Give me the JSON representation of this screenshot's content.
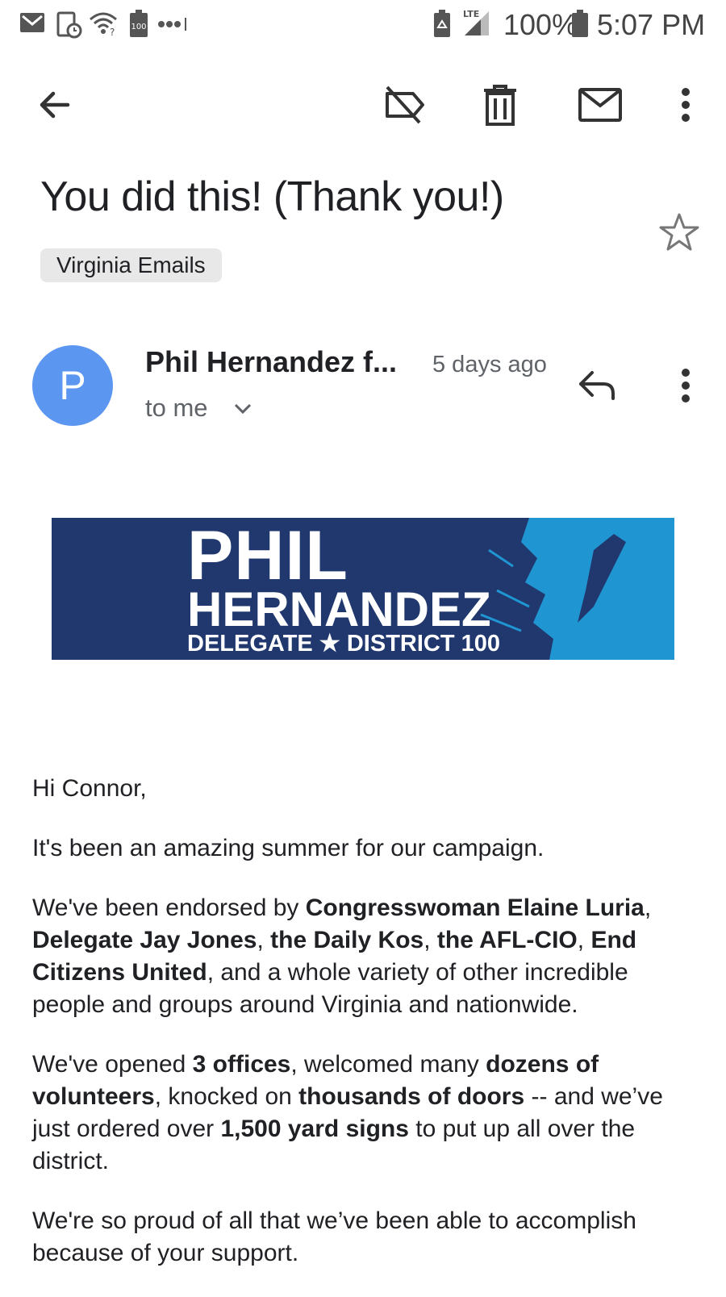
{
  "status_bar": {
    "icons": [
      "gmail-icon",
      "tablet-clock-icon",
      "wifi-icon",
      "battery-100-icon",
      "dots-icon",
      "battery-saver-icon",
      "lte-signal-icon",
      "battery-icon"
    ],
    "lte_label": "LTE",
    "badge_100": "100",
    "battery_percent": "100%",
    "time": "5:07 PM"
  },
  "toolbar": {
    "icons": [
      "back-arrow-icon",
      "label-off-icon",
      "delete-icon",
      "mark-unread-icon",
      "more-vert-icon"
    ]
  },
  "email": {
    "subject": "You did this! (Thank you!)",
    "label": "Virginia Emails",
    "starred": false,
    "sender_initial": "P",
    "sender_name": "Phil Hernandez f...",
    "time": "5 days ago",
    "to": "to me",
    "avatar_color": "#5b96f1"
  },
  "banner": {
    "line1": "PHIL",
    "line2": "HERNANDEZ",
    "line3": "DELEGATE ★ DISTRICT 100",
    "bg_color": "#21386f",
    "accent_color": "#1f95d2"
  },
  "body": {
    "greeting": "Hi Connor,",
    "p1": "It's been an amazing summer for our campaign.",
    "p2": [
      {
        "t": "We've been endorsed by ",
        "b": false
      },
      {
        "t": "Congresswoman Elaine Luria",
        "b": true
      },
      {
        "t": ", ",
        "b": false
      },
      {
        "t": "Delegate Jay Jones",
        "b": true
      },
      {
        "t": ", ",
        "b": false
      },
      {
        "t": "the Daily Kos",
        "b": true
      },
      {
        "t": ", ",
        "b": false
      },
      {
        "t": "the AFL-CIO",
        "b": true
      },
      {
        "t": ", ",
        "b": false
      },
      {
        "t": "End Citizens United",
        "b": true
      },
      {
        "t": ", and a whole variety of other incredible people and groups around Virginia and nationwide.",
        "b": false
      }
    ],
    "p3": [
      {
        "t": "We've opened ",
        "b": false
      },
      {
        "t": "3 offices",
        "b": true
      },
      {
        "t": ", welcomed many ",
        "b": false
      },
      {
        "t": "dozens of volunteers",
        "b": true
      },
      {
        "t": ", knocked on ",
        "b": false
      },
      {
        "t": "thousands of doors",
        "b": true
      },
      {
        "t": " -- and we’ve just ordered over ",
        "b": false
      },
      {
        "t": "1,500 yard signs",
        "b": true
      },
      {
        "t": " to put up all over the district.",
        "b": false
      }
    ],
    "p4": "We're so proud of all that we’ve been able to accomplish because of your support."
  }
}
